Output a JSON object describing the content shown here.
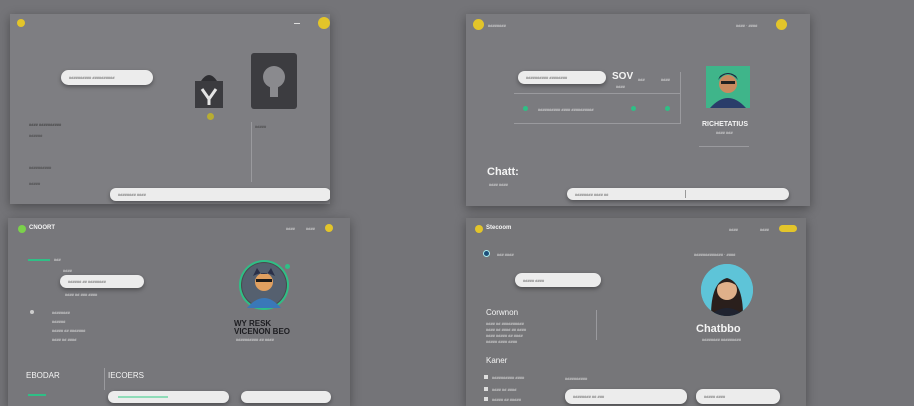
{
  "colors": {
    "accent_yellow": "#e3c52a",
    "accent_green": "#2fbf86",
    "panel_gray": "#7c7c80",
    "pill_white": "#ececec"
  },
  "panel1": {
    "search_placeholder": "########## ##########",
    "menu_label": "#### ##########",
    "menu_sub": "######",
    "side_label_1": "##########",
    "side_label_2": "#####",
    "card_label": "#####",
    "input_placeholder": "######## ####"
  },
  "panel2": {
    "header_text": "########",
    "header_right": "####  ·  ####",
    "search_placeholder": "########## ########",
    "sov": "SOV",
    "sov_sub": "####",
    "row_text": "########## #### ##########",
    "name": "RICHETATIUS",
    "name_sub": "#### ###",
    "title": "Chatt:",
    "title_sub": "#### ####",
    "input_placeholder": "######## #### ##"
  },
  "panel3": {
    "brand": "CNOORT",
    "nav_1": "####",
    "nav_2": "####",
    "progress_label": "###",
    "input_text": "###### ## ########",
    "input_sub": "#### ## ### ####",
    "list": [
      "########",
      "######",
      "##### ## #######",
      "#### ## ####"
    ],
    "person_title_1": "WY RESK",
    "person_title_2": "VICENON BEO",
    "person_sub": "########## ## ####",
    "section_left": "EBODAR",
    "section_right": "IECOERS"
  },
  "panel4": {
    "brand": "Stecoom",
    "nav_1": "####",
    "nav_2": "####",
    "row_label": "### ####",
    "search_placeholder": "##### ####",
    "section_title": "Corwnon",
    "section_lines": [
      "#### ## ##########",
      "####  ## ####  ## ####",
      "#### ##### ## ####",
      "##### ####  ####"
    ],
    "profile_caption": "############# · ####",
    "profile_name": "Chatbbo",
    "profile_sub": "######## #########",
    "kaner": "Kaner",
    "list": [
      "########## ####",
      "#### ## ####",
      "##### ## #####"
    ],
    "col_label": "##########",
    "field_1": "######## ## ###",
    "field_2": "##### ####"
  }
}
